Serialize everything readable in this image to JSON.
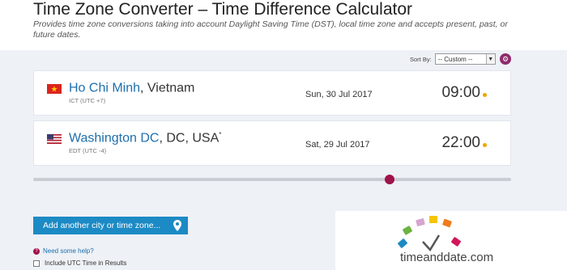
{
  "page": {
    "title": "Time Zone Converter – Time Difference Calculator",
    "subtitle": "Provides time zone conversions taking into account Daylight Saving Time (DST), local time zone and accepts present, past, or future dates."
  },
  "sort": {
    "label": "Sort By:",
    "selected": "-- Custom --"
  },
  "cities": [
    {
      "name": "Ho Chi Minh",
      "region": ", Vietnam",
      "superscript": "",
      "tz": "ICT (UTC +7)",
      "date": "Sun, 30 Jul 2017",
      "time": "09:00",
      "flag": "vietnam-flag"
    },
    {
      "name": "Washington DC",
      "region": ", DC, USA",
      "superscript": "*",
      "tz": "EDT (UTC -4)",
      "date": "Sat, 29 Jul 2017",
      "time": "22:00",
      "flag": "usa-flag"
    }
  ],
  "slider": {
    "position": 0.745
  },
  "add_button": {
    "label": "Add another city or time zone...",
    "icon": "location-pin-icon"
  },
  "help": {
    "label": "Need some help?"
  },
  "utc_option": {
    "label": "Include UTC Time in Results",
    "checked": false
  },
  "logo": {
    "text": "timeanddate.com"
  },
  "colors": {
    "link_blue": "#1d6fae",
    "button_blue": "#1c8ac4",
    "accent_magenta": "#a0124a",
    "time_dot": "#f0a500",
    "background": "#eef1f6"
  }
}
